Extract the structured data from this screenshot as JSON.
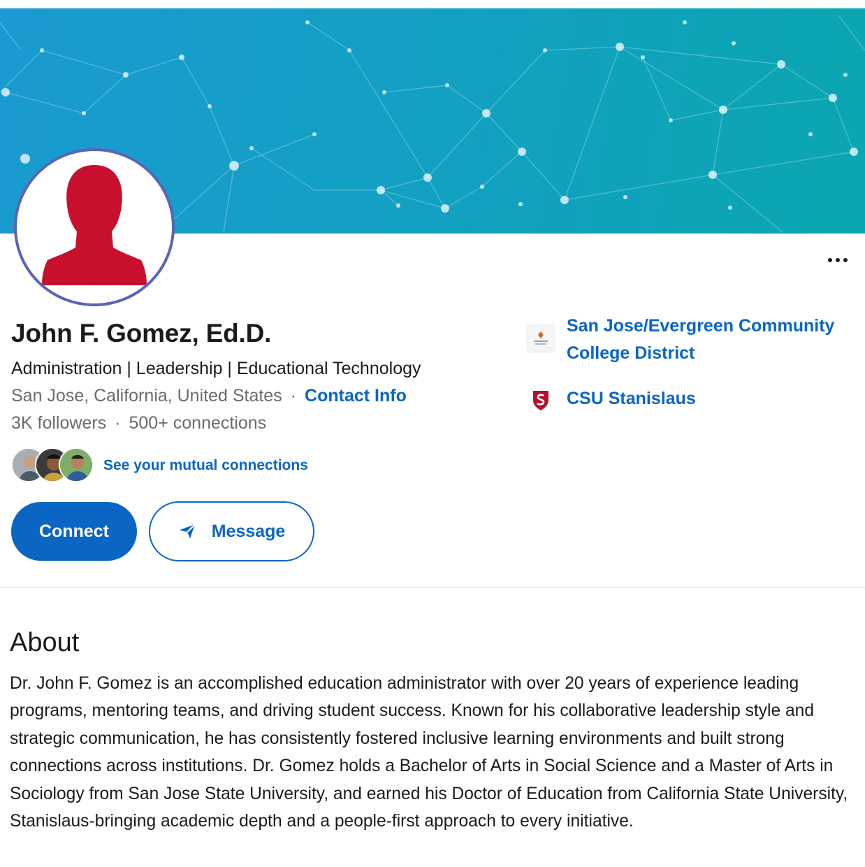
{
  "profile": {
    "name": "John F. Gomez, Ed.D.",
    "headline": "Administration | Leadership | Educational Technology",
    "location": "San Jose, California, United States",
    "separator": "·",
    "contact_info_label": "Contact Info",
    "followers": "3K followers",
    "connections": "500+ connections",
    "mutual_connections_label": "See your mutual connections"
  },
  "actions": {
    "connect_label": "Connect",
    "message_label": "Message",
    "more_icon": "more-horizontal-icon"
  },
  "organizations": [
    {
      "name": "San Jose/Evergreen Community College District",
      "line1": "San Jose/Evergreen Community",
      "line2": "College District",
      "icon": "college-district-logo"
    },
    {
      "name": "CSU Stanislaus",
      "icon": "csu-stanislaus-shield-logo"
    }
  ],
  "about": {
    "title": "About",
    "text": "Dr. John F. Gomez is an accomplished education administrator with over 20 years of experience leading programs, mentoring teams, and driving student success. Known for his collaborative leadership style and strategic communication, he has consistently fostered inclusive learning environments and built strong connections across institutions. Dr. Gomez holds a Bachelor of Arts in Social Science and a Master of Arts in Sociology from San Jose State University, and earned his Doctor of Education from California State University, Stanislaus-bringing academic depth and a people-first approach to every initiative."
  },
  "colors": {
    "brand_blue": "#0a66c2",
    "banner_start": "#1a9ad0",
    "banner_end": "#0aa6b0",
    "avatar_silhouette": "#c8102e",
    "avatar_ring": "#5a63b8"
  }
}
